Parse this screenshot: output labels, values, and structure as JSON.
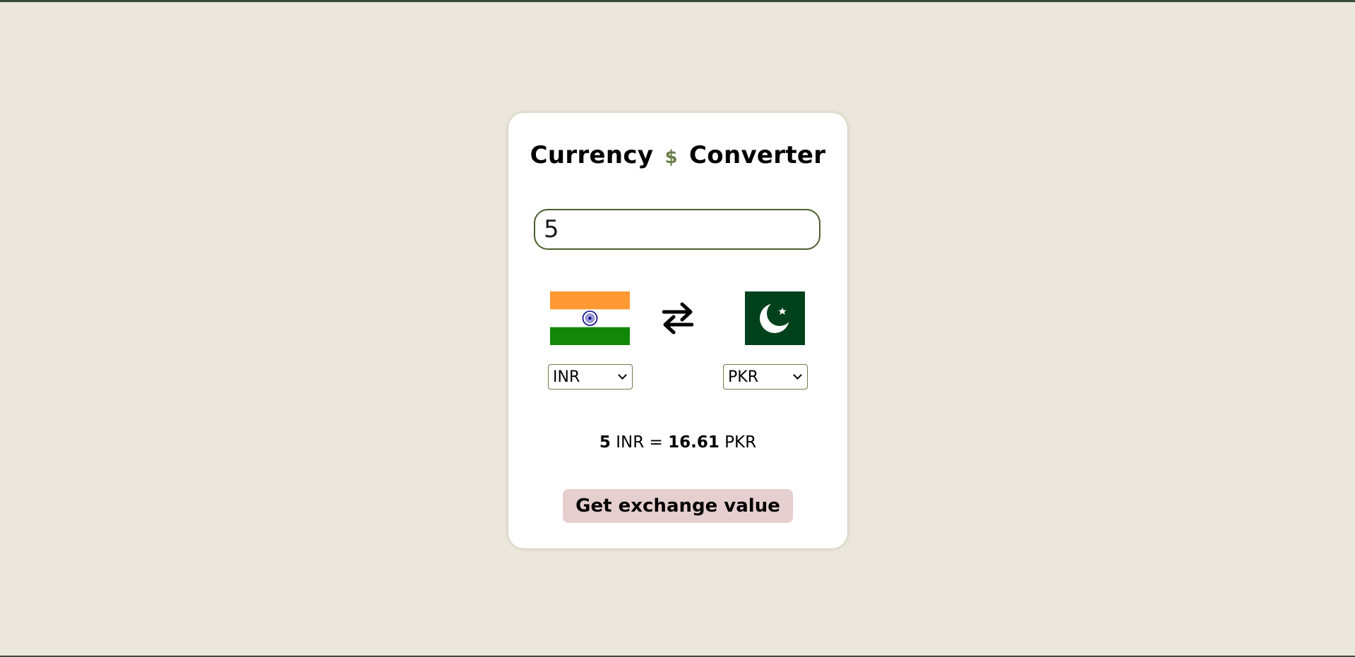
{
  "title": {
    "left": "Currency",
    "symbol": "$",
    "right": "Converter"
  },
  "amount": {
    "value": "5"
  },
  "from": {
    "currency": "INR",
    "flag_icon": "india-flag-icon"
  },
  "to": {
    "currency": "PKR",
    "flag_icon": "pakistan-flag-icon"
  },
  "swap_icon": "swap-arrows-icon",
  "result": {
    "amount": "5",
    "from_code": "INR",
    "equals": "=",
    "converted": "16.61",
    "to_code": "PKR"
  },
  "button": {
    "label": "Get exchange value"
  },
  "colors": {
    "page_background": "#ebe7dc",
    "card_background": "#ffffff",
    "accent_green": "#4b5e2c",
    "button_background": "#e6cfcf"
  }
}
